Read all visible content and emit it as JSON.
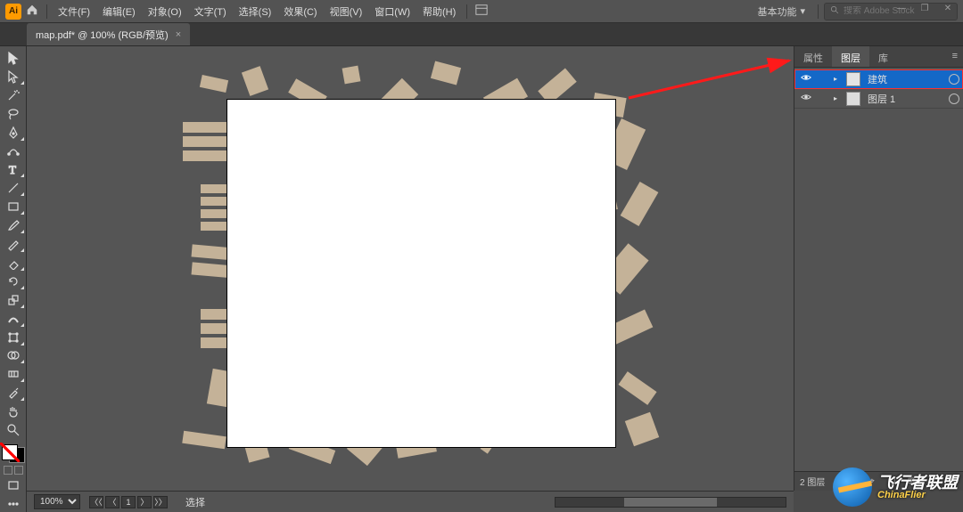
{
  "app": {
    "logo_text": "Ai"
  },
  "menus": [
    "文件(F)",
    "编辑(E)",
    "对象(O)",
    "文字(T)",
    "选择(S)",
    "效果(C)",
    "视图(V)",
    "窗口(W)",
    "帮助(H)"
  ],
  "workspace": {
    "label": "基本功能"
  },
  "search": {
    "placeholder": "搜索 Adobe Stock"
  },
  "window_controls": {
    "min": "—",
    "max": "❐",
    "close": "✕"
  },
  "tab": {
    "title": "map.pdf* @ 100% (RGB/预览)",
    "close": "×"
  },
  "panels": {
    "tabs": [
      "属性",
      "图层",
      "库"
    ],
    "active_tab_index": 1,
    "layers": [
      {
        "name": "建筑",
        "visible": true,
        "selected": true
      },
      {
        "name": "图层 1",
        "visible": true,
        "selected": false
      }
    ],
    "status": {
      "count_label": "2 图层"
    }
  },
  "status": {
    "zoom": "100%",
    "mode": "选择"
  },
  "watermark": {
    "cn": "飞行者联盟",
    "en": "ChinaFlier"
  },
  "tool_names": [
    "selection-tool",
    "direct-selection-tool",
    "magic-wand-tool",
    "lasso-tool",
    "pen-tool",
    "curvature-tool",
    "type-tool",
    "line-tool",
    "rectangle-tool",
    "paintbrush-tool",
    "shaper-tool",
    "eraser-tool",
    "rotate-tool",
    "scale-tool",
    "width-tool",
    "free-transform-tool",
    "shape-builder-tool",
    "perspective-tool",
    "mesh-tool",
    "gradient-tool",
    "eyedropper-tool",
    "blend-tool",
    "symbol-tool",
    "graph-tool",
    "artboard-tool",
    "slice-tool",
    "hand-tool",
    "zoom-tool"
  ]
}
